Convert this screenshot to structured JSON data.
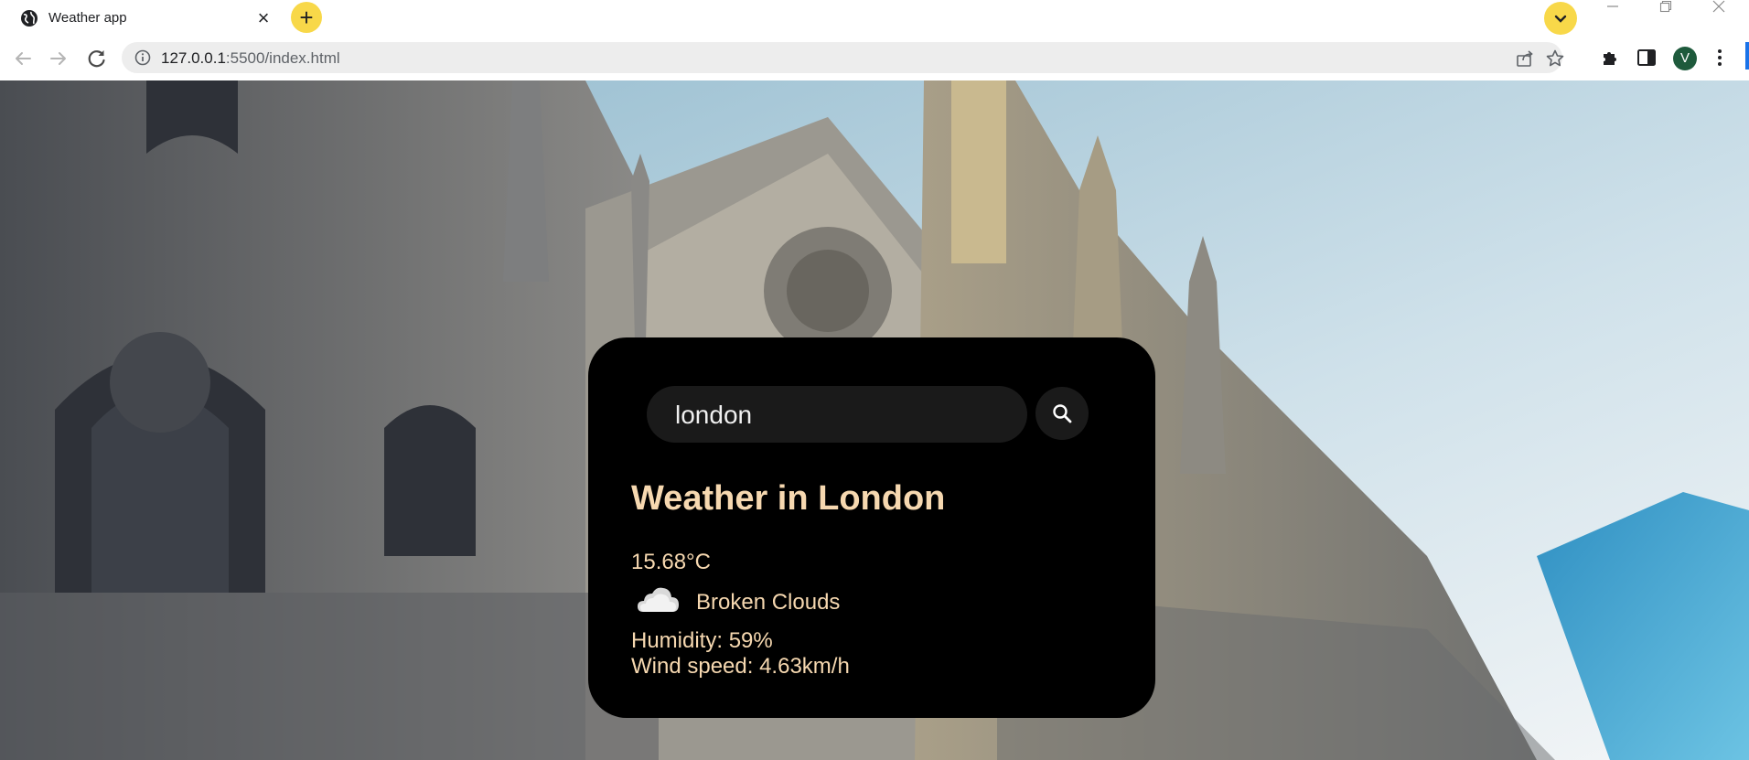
{
  "browser": {
    "tab_title": "Weather app",
    "tab_close": "×",
    "new_tab": "+",
    "url_host": "127.0.0.1",
    "url_rest": ":5500/index.html",
    "profile_initial": "V"
  },
  "weather": {
    "search_value": "london",
    "heading": "Weather in London",
    "temperature": "15.68°C",
    "condition": "Broken Clouds",
    "humidity": "Humidity: 59%",
    "wind": "Wind speed: 4.63km/h"
  },
  "icons": {
    "tab": "globe-icon",
    "search": "search-icon",
    "condition": "cloud-icon"
  },
  "colors": {
    "card_bg": "#000000",
    "card_text": "#f6d8b0",
    "chrome_accent": "#f8d849"
  }
}
